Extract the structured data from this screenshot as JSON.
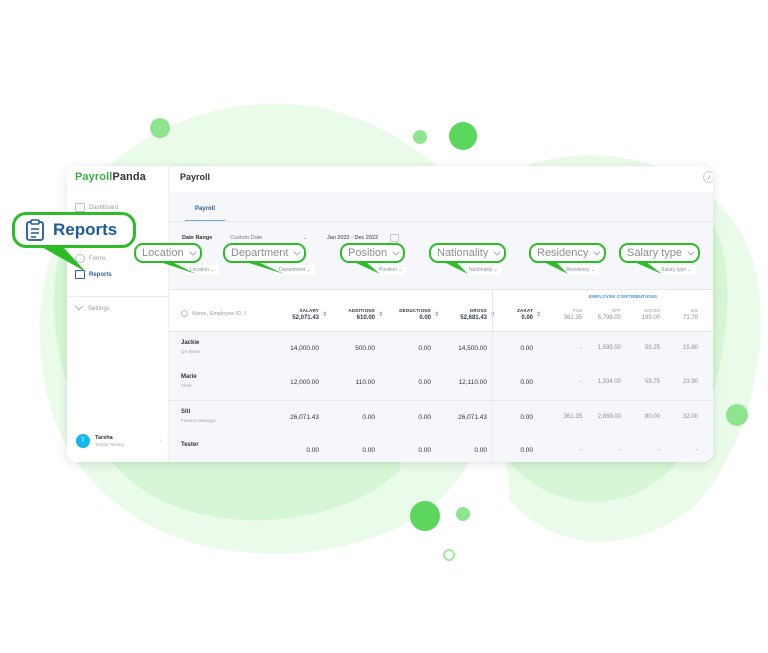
{
  "brand": {
    "part1": "Payroll",
    "part2": "Panda"
  },
  "page_title": "Payroll",
  "sidebar": {
    "items": [
      {
        "label": "Dashboard",
        "icon": "dashboard-icon",
        "active": false
      },
      {
        "label": "Forms",
        "icon": "forms-icon",
        "active": false
      },
      {
        "label": "Reports",
        "icon": "clipboard-icon",
        "active": true
      }
    ],
    "settings_label": "Settings",
    "user": {
      "initial": "T",
      "name": "Tarsha",
      "subtitle": "Tarsha Testing"
    }
  },
  "tabs": [
    {
      "label": "Payroll",
      "active": true
    }
  ],
  "date_filter": {
    "label": "Date Range",
    "mode": "Custom Date",
    "range": "Jan 2022 - Dec 2022"
  },
  "filters": [
    {
      "label": "Location"
    },
    {
      "label": "Department"
    },
    {
      "label": "Position"
    },
    {
      "label": "Nationality"
    },
    {
      "label": "Residency"
    },
    {
      "label": "Salary type"
    }
  ],
  "callout_reports": "Reports",
  "search": {
    "placeholder": "Name, Employee ID, I"
  },
  "table": {
    "contrib_group": "EMPLOYEE CONTRIBUTIONS",
    "columns": [
      {
        "key": "salary",
        "label": "SALARY",
        "total": "52,071.43"
      },
      {
        "key": "additions",
        "label": "ADDITIONS",
        "total": "610.00"
      },
      {
        "key": "deductions",
        "label": "DEDUCTIONS",
        "total": "0.00"
      },
      {
        "key": "gross",
        "label": "GROSS",
        "total": "52,681.43"
      },
      {
        "key": "zakat",
        "label": "ZAKAT",
        "total": "0.00"
      },
      {
        "key": "pcb",
        "label": "PCB",
        "total": "361.35"
      },
      {
        "key": "epf",
        "label": "EPF",
        "total": "5,798.00"
      },
      {
        "key": "socso",
        "label": "SOCSO",
        "total": "199.00"
      },
      {
        "key": "eis",
        "label": "EIS",
        "total": "71.70"
      }
    ],
    "rows": [
      {
        "name": "Jackie",
        "position": "QA Tester",
        "salary": "14,000.00",
        "additions": "500.00",
        "deductions": "0.00",
        "gross": "14,500.00",
        "zakat": "0.00",
        "pcb": "-",
        "epf": "1,595.00",
        "socso": "59.25",
        "eis": "15.80"
      },
      {
        "name": "Marie",
        "position": "Clerk",
        "salary": "12,000.00",
        "additions": "110.00",
        "deductions": "0.00",
        "gross": "12,110.00",
        "zakat": "0.00",
        "pcb": "-",
        "epf": "1,334.00",
        "socso": "59.75",
        "eis": "23.90"
      },
      {
        "name": "Siti",
        "position": "Finance Manager",
        "salary": "26,071.43",
        "additions": "0.00",
        "deductions": "0.00",
        "gross": "26,071.43",
        "zakat": "0.00",
        "pcb": "361.35",
        "epf": "2,869.00",
        "socso": "80.00",
        "eis": "32.00"
      },
      {
        "name": "Tester",
        "position": "",
        "salary": "0.00",
        "additions": "0.00",
        "deductions": "0.00",
        "gross": "0.00",
        "zakat": "0.00",
        "pcb": "-",
        "epf": "-",
        "socso": "-",
        "eis": "-"
      }
    ]
  },
  "colors": {
    "brand_green": "#3cb043",
    "callout_green": "#2dbb28",
    "accent_blue": "#2f5d99",
    "avatar": "#12b7ef"
  }
}
